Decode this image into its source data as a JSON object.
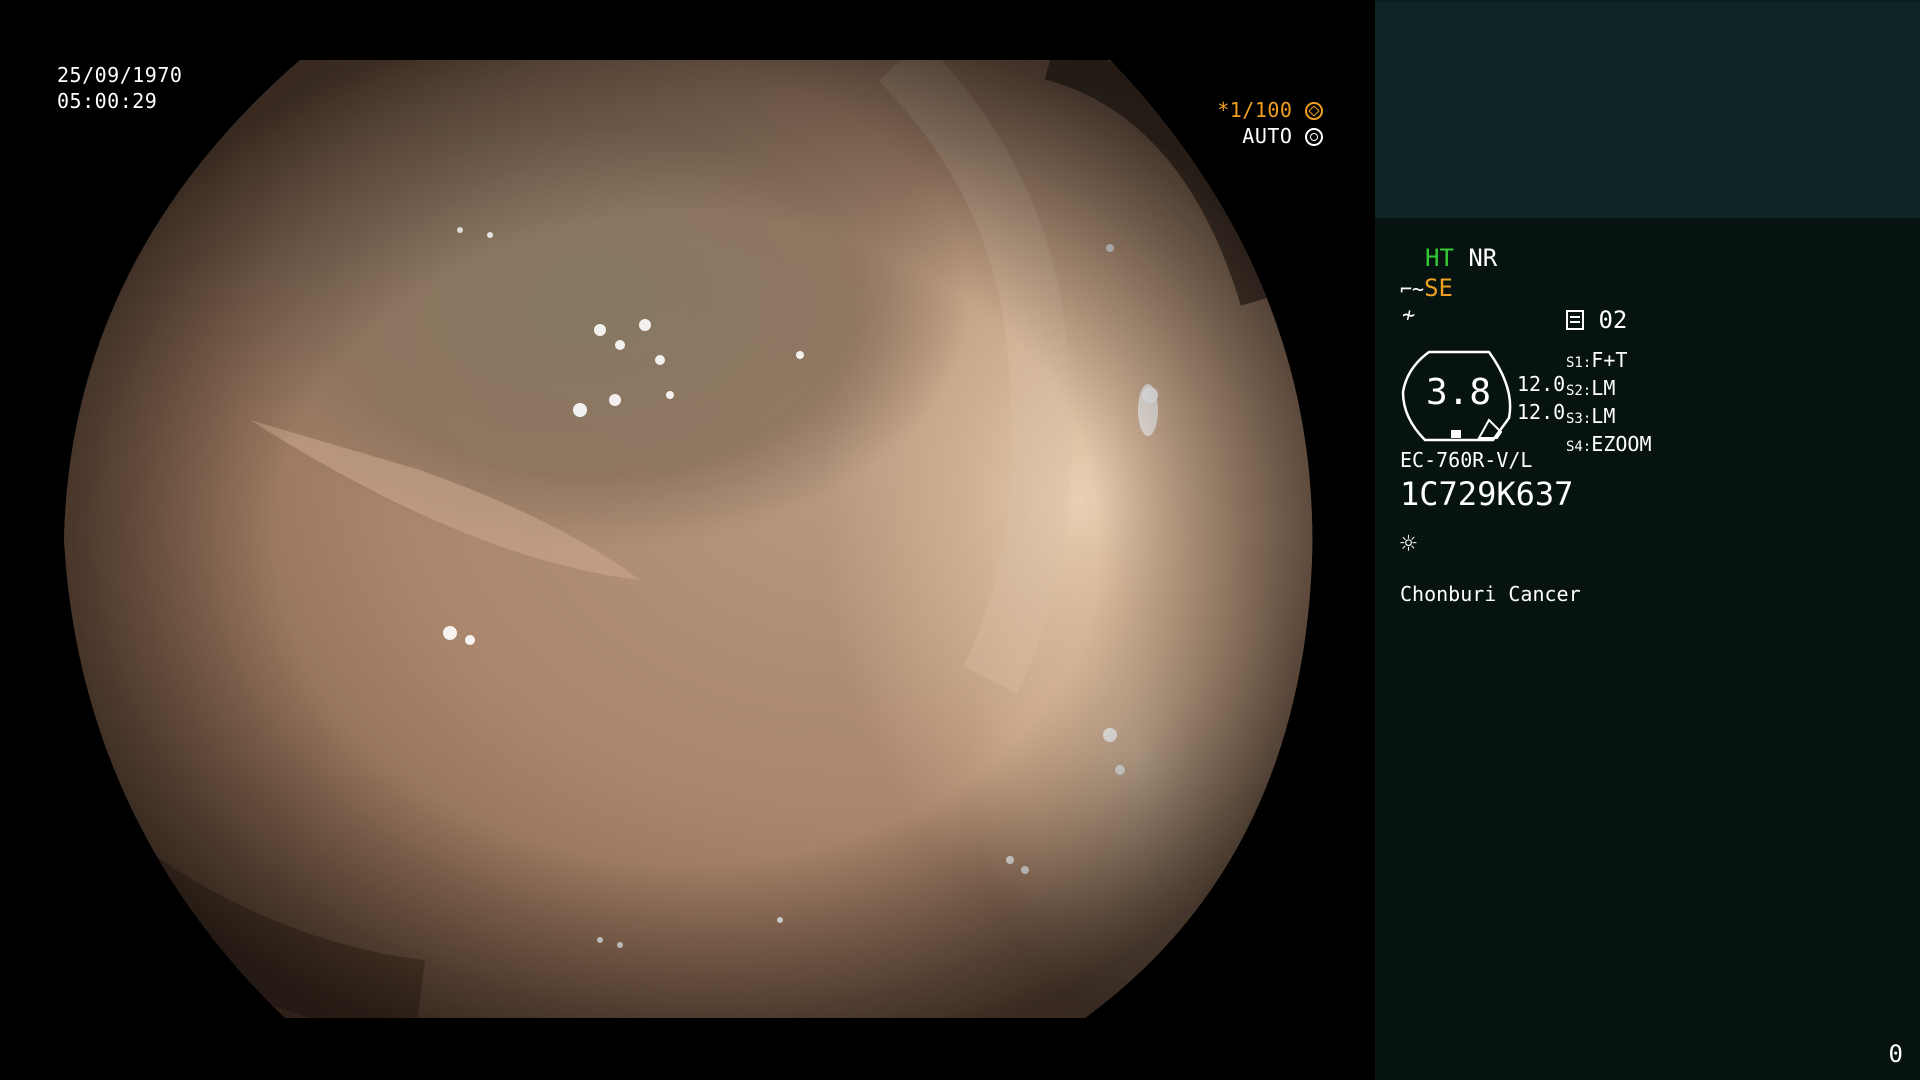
{
  "overlay": {
    "date": "25/09/1970",
    "time": "05:00:29",
    "shutter_speed": "*1/100",
    "iris_mode": "AUTO"
  },
  "panel": {
    "ht": "HT",
    "nr": "NR",
    "se": "SE",
    "memory_channel": "02",
    "zoom_value": "3.8",
    "value_1": "12.0",
    "value_2": "12.0",
    "switches": [
      {
        "label": "S1:",
        "value": "F+T"
      },
      {
        "label": "S2:",
        "value": "LM"
      },
      {
        "label": "S3:",
        "value": "LM"
      },
      {
        "label": "S4:",
        "value": "EZOOM"
      }
    ],
    "scope_model": "EC-760R-V/L",
    "scope_serial": "1C729K637",
    "institution": "Chonburi Cancer",
    "counter": "0"
  },
  "colors": {
    "panel_bg": "#061310",
    "panel_top_bg": "#0e2526",
    "green": "#33cc33",
    "orange": "#f0a020"
  },
  "icons": [
    "shutter-icon",
    "iris-icon",
    "structure-enhance-icon",
    "color-tone-icon",
    "memory-icon",
    "light-source-icon"
  ]
}
